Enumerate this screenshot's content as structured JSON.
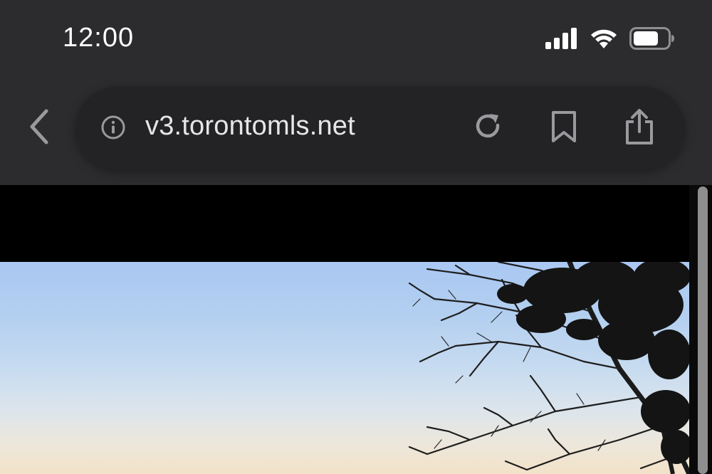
{
  "status_bar": {
    "time": "12:00",
    "cellular_icon": "signal-bars-icon",
    "wifi_icon": "wifi-icon",
    "battery_icon": "battery-icon",
    "battery_level": 0.7
  },
  "toolbar": {
    "back_icon": "chevron-left-icon",
    "url": "v3.torontomls.net",
    "info_icon": "info-circle-icon",
    "reload_icon": "reload-icon",
    "bookmark_icon": "bookmark-icon",
    "share_icon": "share-icon"
  },
  "content": {
    "image_description_icon": "photo-tree-silhouette"
  },
  "colors": {
    "chrome_bg": "#2c2c2e",
    "pill_bg": "#232325",
    "icon_gray": "#9a9a9e",
    "text": "#e6e6e8"
  }
}
